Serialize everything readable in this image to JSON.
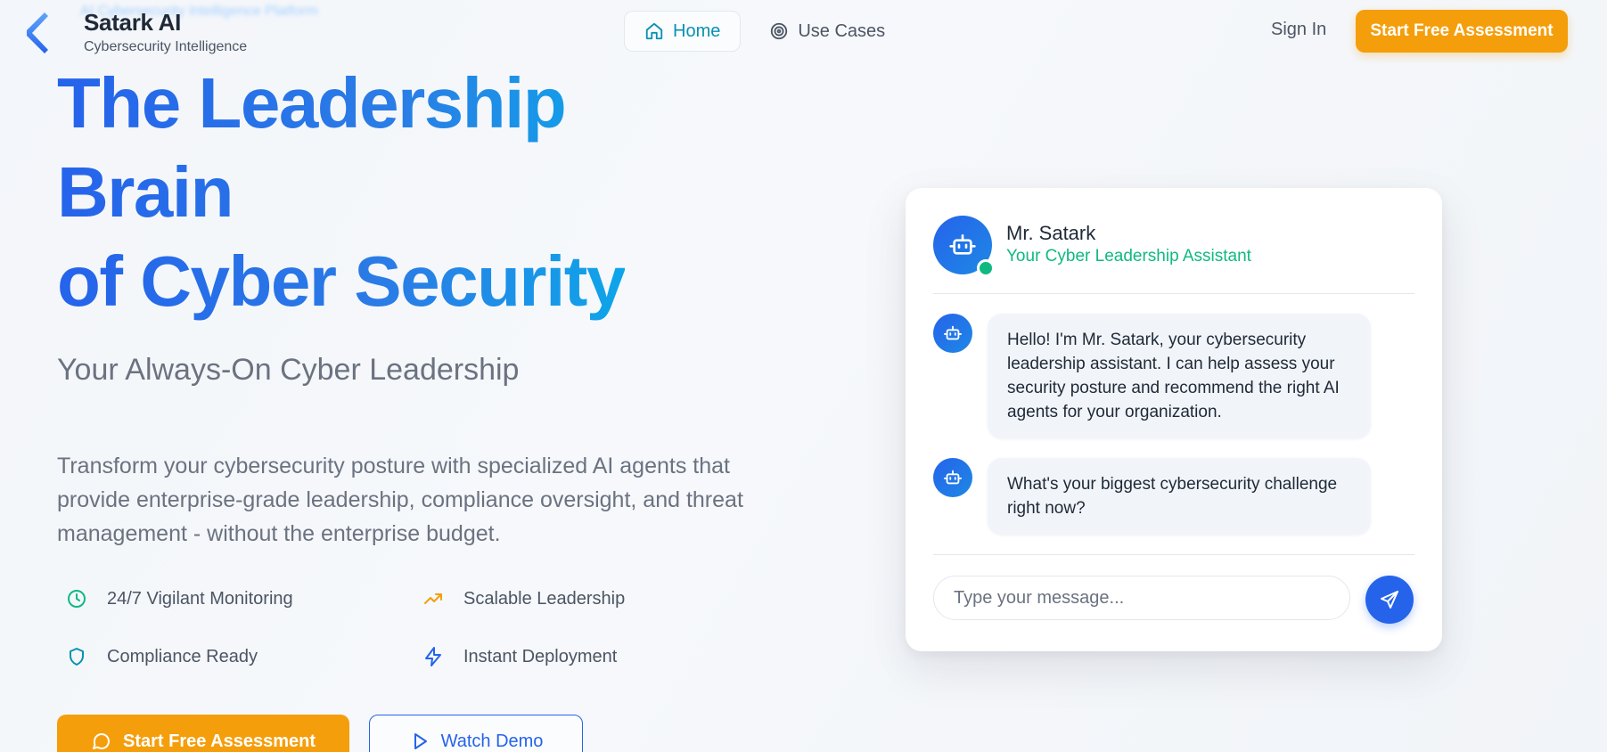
{
  "header": {
    "brand_name": "Satark AI",
    "brand_subtitle": "Cybersecurity Intelligence",
    "ghost_text": "AI Cybersecurity Intelligence Platform",
    "nav": [
      {
        "label": "Home",
        "icon": "home-icon",
        "active": true
      },
      {
        "label": "Use Cases",
        "icon": "target-icon",
        "active": false
      }
    ],
    "sign_in": "Sign In",
    "cta": "Start Free Assessment"
  },
  "hero": {
    "title_lines": [
      "The Leadership",
      "Brain",
      "of Cyber Security"
    ],
    "subtitle": "Your Always-On Cyber Leadership",
    "description": "Transform your cybersecurity posture with specialized AI agents that provide enterprise-grade leadership, compliance oversight, and threat management - without the enterprise budget.",
    "features": [
      {
        "label": "24/7 Vigilant Monitoring",
        "icon": "clock-icon"
      },
      {
        "label": "Scalable Leadership",
        "icon": "trending-up-icon"
      },
      {
        "label": "Compliance Ready",
        "icon": "shield-icon"
      },
      {
        "label": "Instant Deployment",
        "icon": "lightning-icon"
      }
    ],
    "primary_button": "Start Free Assessment",
    "secondary_button": "Watch Demo"
  },
  "chat": {
    "assistant_name": "Mr. Satark",
    "assistant_role": "Your Cyber Leadership Assistant",
    "messages": [
      {
        "from": "bot",
        "text": "Hello! I'm Mr. Satark, your cybersecurity leadership assistant. I can help assess your security posture and recommend the right AI agents for your organization."
      },
      {
        "from": "bot",
        "text": "What's your biggest cybersecurity challenge right now?"
      }
    ],
    "input_placeholder": "Type your message...",
    "input_value": ""
  },
  "colors": {
    "accent_blue": "#2563eb",
    "accent_orange": "#f59e0b",
    "online_green": "#10b981",
    "nav_active": "#0891b2"
  }
}
